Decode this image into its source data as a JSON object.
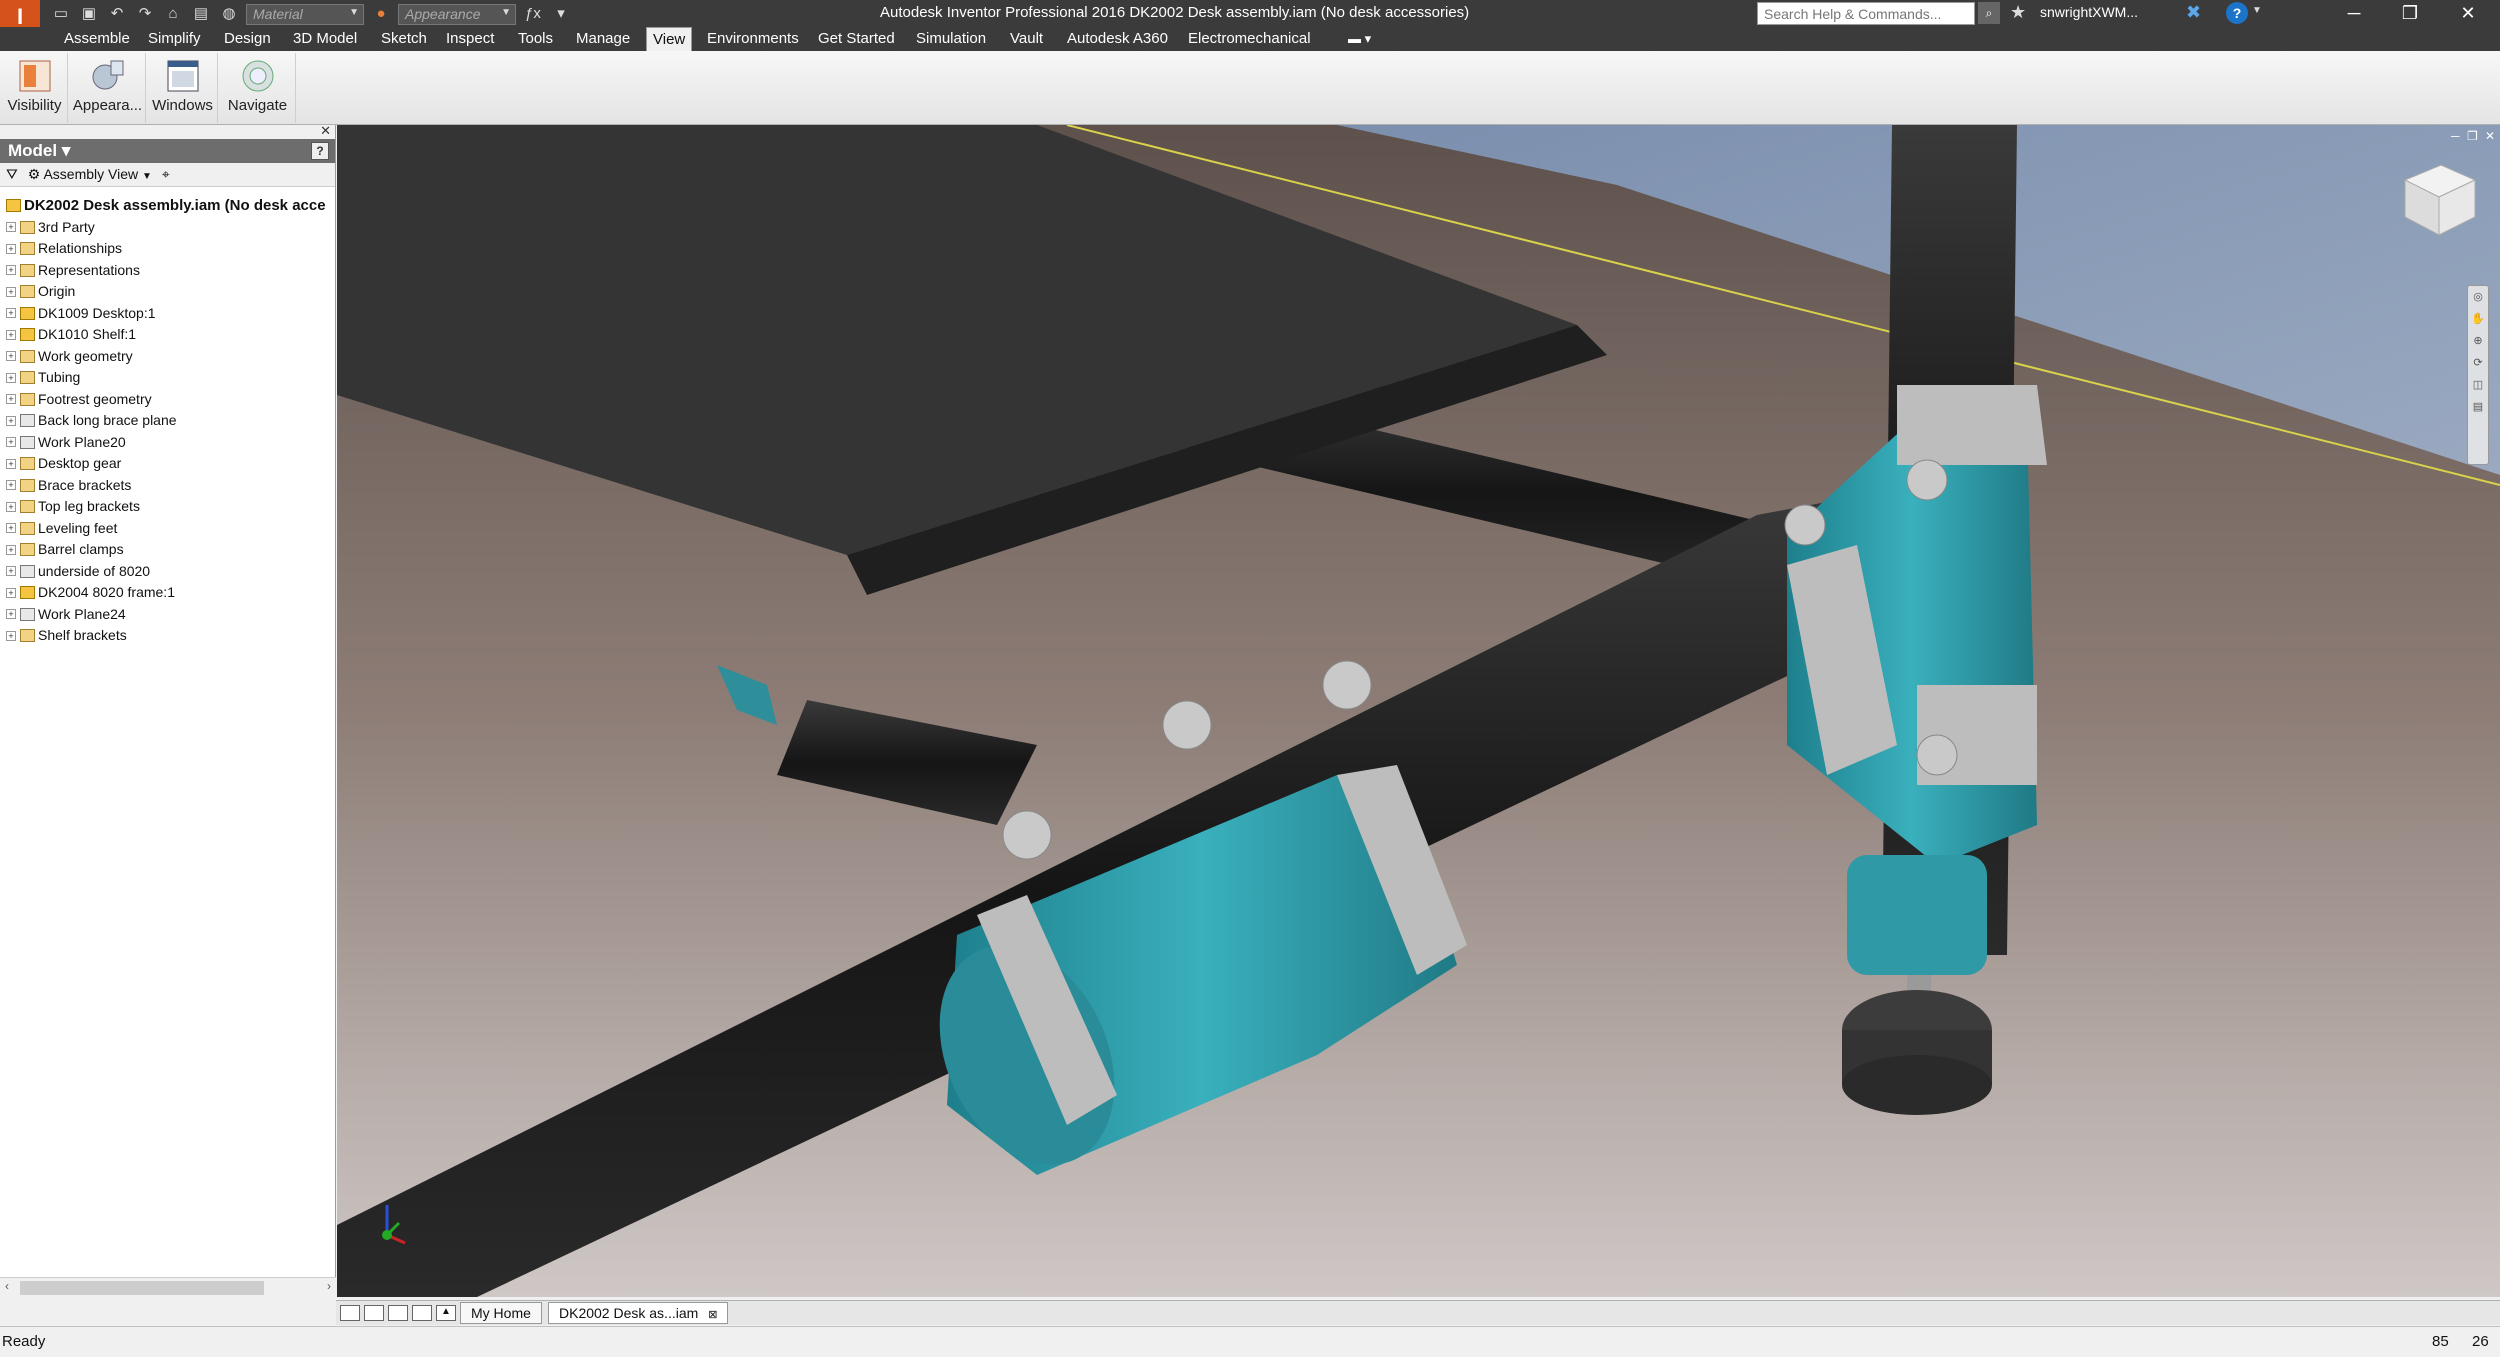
{
  "window": {
    "app_initials": "I",
    "title": "Autodesk Inventor Professional 2016    DK2002 Desk assembly.iam (No desk accessories)",
    "search_placeholder": "Search Help & Commands...",
    "user": "snwrightXWM...",
    "minimize": "─",
    "restore": "❐",
    "close": "✕"
  },
  "quick_access": {
    "material": "Material",
    "appearance": "Appearance",
    "fx": "ƒx"
  },
  "tabs": [
    "Assemble",
    "Simplify",
    "Design",
    "3D Model",
    "Sketch",
    "Inspect",
    "Tools",
    "Manage",
    "View",
    "Environments",
    "Get Started",
    "Simulation",
    "Vault",
    "Autodesk A360",
    "Electromechanical"
  ],
  "active_tab": "View",
  "ribbon": {
    "visibility": "Visibility",
    "appearance": "Appeara...",
    "windows": "Windows",
    "navigate": "Navigate"
  },
  "browser": {
    "title": "Model ▾",
    "view": "Assembly View",
    "root": "DK2002 Desk assembly.iam (No desk acce",
    "items": [
      {
        "label": "3rd Party",
        "type": "folder"
      },
      {
        "label": "Relationships",
        "type": "folder"
      },
      {
        "label": "Representations",
        "type": "folder"
      },
      {
        "label": "Origin",
        "type": "folder"
      },
      {
        "label": "DK1009 Desktop:1",
        "type": "part"
      },
      {
        "label": "DK1010 Shelf:1",
        "type": "part"
      },
      {
        "label": "Work geometry",
        "type": "folder"
      },
      {
        "label": "Tubing",
        "type": "folder"
      },
      {
        "label": "Footrest geometry",
        "type": "folder"
      },
      {
        "label": "Back long brace plane",
        "type": "plane"
      },
      {
        "label": "Work Plane20",
        "type": "plane"
      },
      {
        "label": "Desktop gear",
        "type": "folder"
      },
      {
        "label": "Brace brackets",
        "type": "folder"
      },
      {
        "label": "Top leg brackets",
        "type": "folder"
      },
      {
        "label": "Leveling feet",
        "type": "folder"
      },
      {
        "label": "Barrel clamps",
        "type": "folder"
      },
      {
        "label": "underside of 8020",
        "type": "plane"
      },
      {
        "label": "DK2004 8020 frame:1",
        "type": "part"
      },
      {
        "label": "Work Plane24",
        "type": "plane"
      },
      {
        "label": "Shelf brackets",
        "type": "folder"
      }
    ]
  },
  "doc_tabs": {
    "home": "My Home",
    "active": "DK2002 Desk as...iam"
  },
  "status": {
    "text": "Ready",
    "count1": "85",
    "count2": "26"
  },
  "colors": {
    "teal": "#2f9aa6",
    "metal": "#b7b7b7",
    "tube": "#1d1d1d",
    "desktop": "#2e2e2e"
  }
}
